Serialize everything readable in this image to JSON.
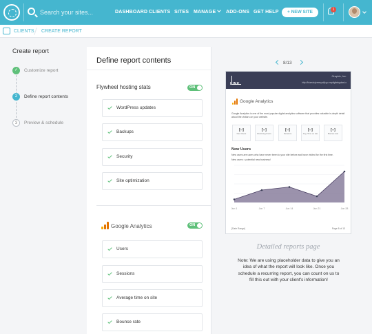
{
  "topbar": {
    "search_placeholder": "Search your sites...",
    "nav": [
      "DASHBOARD",
      "CLIENTS",
      "SITES",
      "MANAGE",
      "ADD-ONS",
      "GET HELP"
    ],
    "new_site_label": "+ NEW SITE",
    "notification_count": "1"
  },
  "breadcrumb": {
    "clients": "CLIENTS",
    "create_report": "CREATE REPORT"
  },
  "sidebar": {
    "title": "Create report",
    "steps": [
      {
        "num": "✓",
        "label": "Customize report",
        "state": "done"
      },
      {
        "num": "2",
        "label": "Define report contents",
        "state": "active"
      },
      {
        "num": "3",
        "label": "Preview & schedule",
        "state": "pending"
      }
    ]
  },
  "main": {
    "title": "Define report contents",
    "flywheel": {
      "title": "Flywheel hosting stats",
      "toggle": "ON",
      "items": [
        "WordPress updates",
        "Backups",
        "Security",
        "Site optimization"
      ]
    },
    "analytics": {
      "title": "Google Analytics",
      "toggle": "ON",
      "items": [
        "Users",
        "Sessions",
        "Average time on site",
        "Bounce rate"
      ]
    }
  },
  "preview": {
    "page_indicator": "8/13",
    "report": {
      "logo_text": "LINK",
      "client_name": "Graphic, Inc.",
      "url": "http://bluevia.jeremy.stjb.go.mydigitalsgolas.io",
      "ga_title": "Google Analytics",
      "description": "Google Analytics is one of the most popular digital analytics software that provides valuable in-depth detail about the visitors on your website.",
      "metrics": [
        {
          "value": "[--]",
          "label": "New Users"
        },
        {
          "value": "[--]",
          "label": "Returning Users"
        },
        {
          "value": "[--]",
          "label": "Sessions"
        },
        {
          "value": "[--]",
          "label": "Avg. Time on site"
        },
        {
          "value": "[--]",
          "label": "Bounce rate"
        }
      ],
      "section_title": "New Users",
      "section_sub1": "New users are users who have never been to your site before and have visited for the first time.",
      "section_sub2": "New users = potential new business!",
      "footer_left": "[Date Range]",
      "footer_right": "Page 8 of 13"
    },
    "caption": "Detailed reports page",
    "note": "Note: We are using placeholder data to give you an idea of what the report will look like. Once you schedule a recurring report, you can count on us to fill this out with your client's information!"
  },
  "colors": {
    "accent": "#45b6cf",
    "success": "#5fc07a",
    "report_header": "#3a3e56",
    "chart_fill": "#8a7f9e"
  },
  "chart_data": {
    "type": "area",
    "categories": [
      "Jun 1",
      "Jun 7",
      "Jun 14",
      "Jun 21",
      "Jun 28"
    ],
    "values": [
      1,
      4,
      5,
      2,
      10
    ],
    "ylim": [
      0,
      12
    ]
  }
}
